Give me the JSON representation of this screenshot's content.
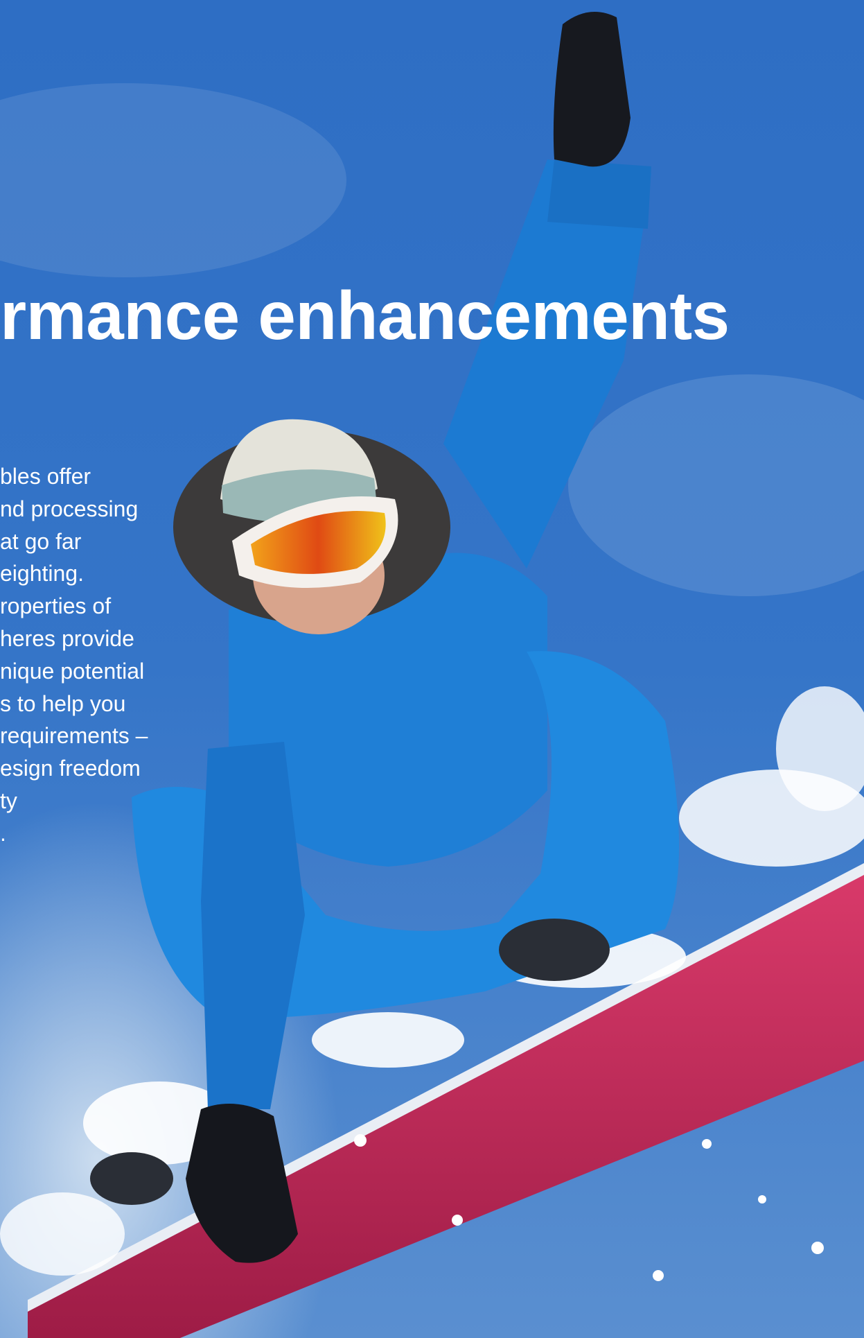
{
  "heading": "rmance enhancements",
  "body_lines": [
    "bles offer",
    "nd processing",
    "at go far",
    "eighting.",
    "roperties of",
    "heres provide",
    "nique potential",
    "s to help you",
    "requirements –",
    "esign freedom",
    "ty",
    "."
  ],
  "colors": {
    "sky": "#2f6fc4",
    "jacket": "#1f7fd6",
    "board": "#c8285a",
    "text": "#ffffff"
  }
}
